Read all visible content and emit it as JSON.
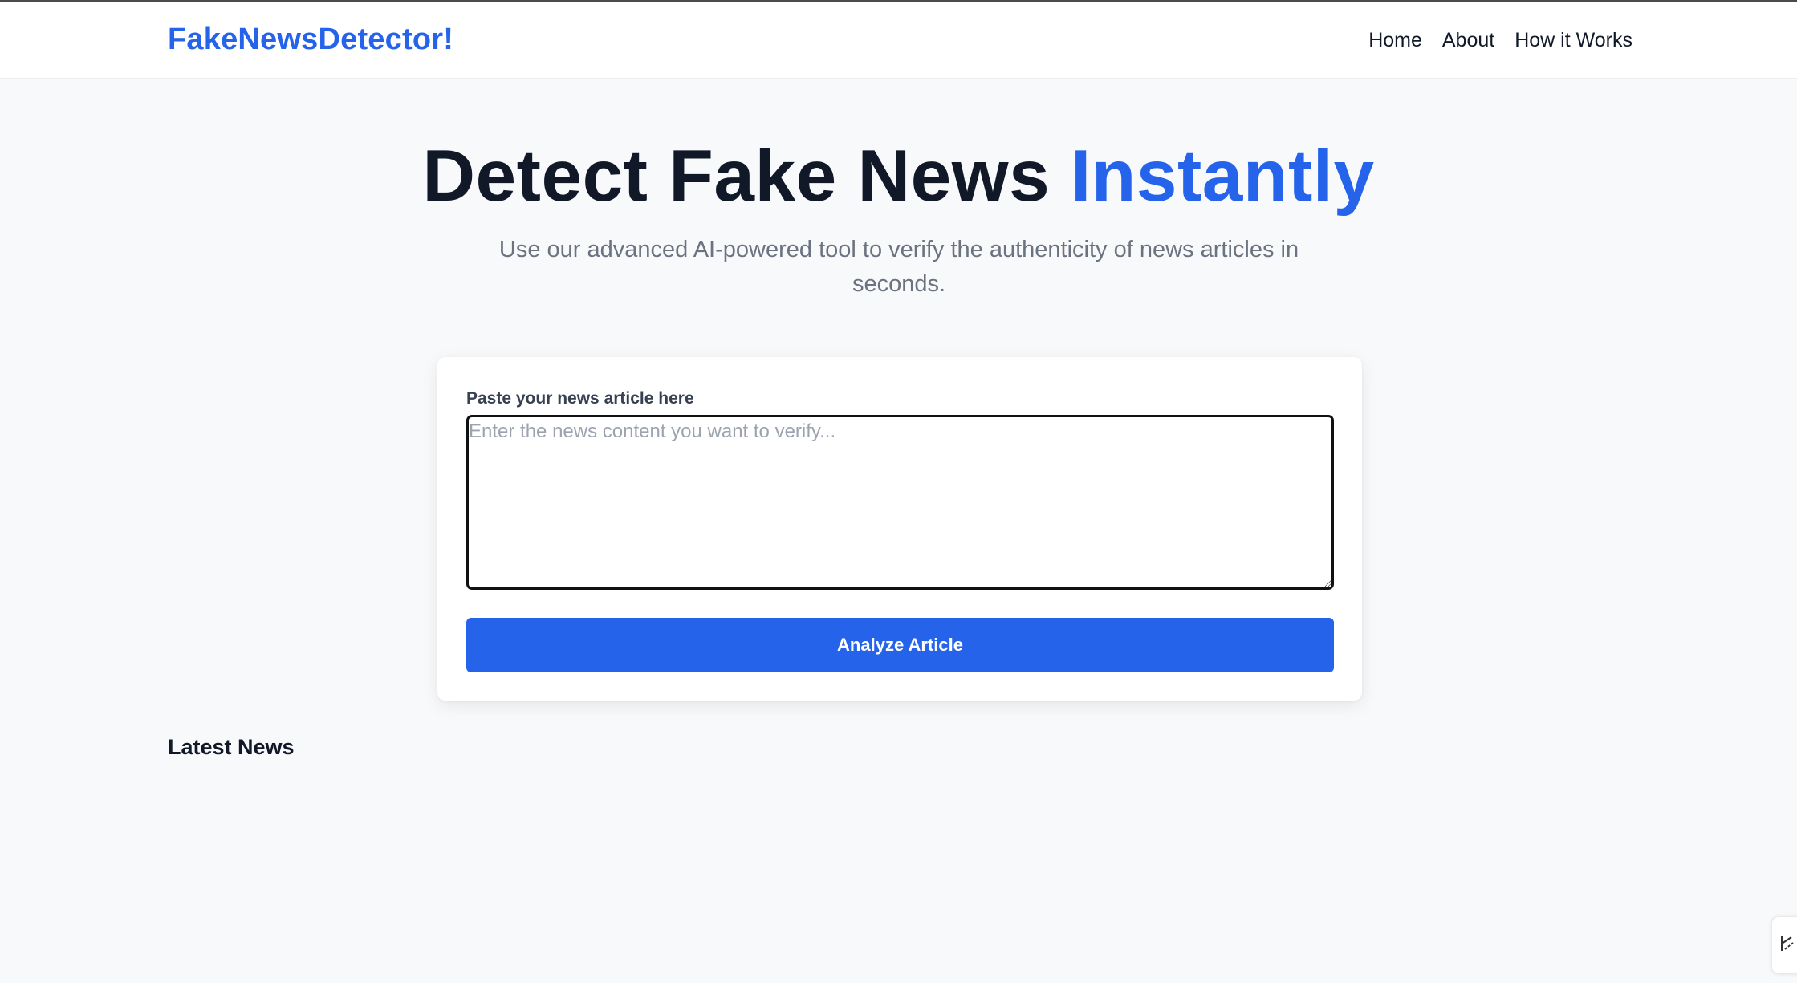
{
  "navbar": {
    "brand": "FakeNewsDetector!",
    "links": [
      "Home",
      "About",
      "How it Works"
    ]
  },
  "hero": {
    "title_main": "Detect Fake News ",
    "title_accent": "Instantly",
    "subtitle": "Use our advanced AI-powered tool to verify the authenticity of news articles in seconds."
  },
  "form": {
    "label": "Paste your news article here",
    "placeholder": "Enter the news content you want to verify...",
    "value": "",
    "submit_label": "Analyze Article"
  },
  "latest": {
    "title": "Latest News"
  },
  "widget": {
    "icon": "extension-handle-icon"
  },
  "colors": {
    "accent": "#2563eb",
    "text": "#111827",
    "muted": "#6b7280",
    "background": "#f8f9fb"
  }
}
